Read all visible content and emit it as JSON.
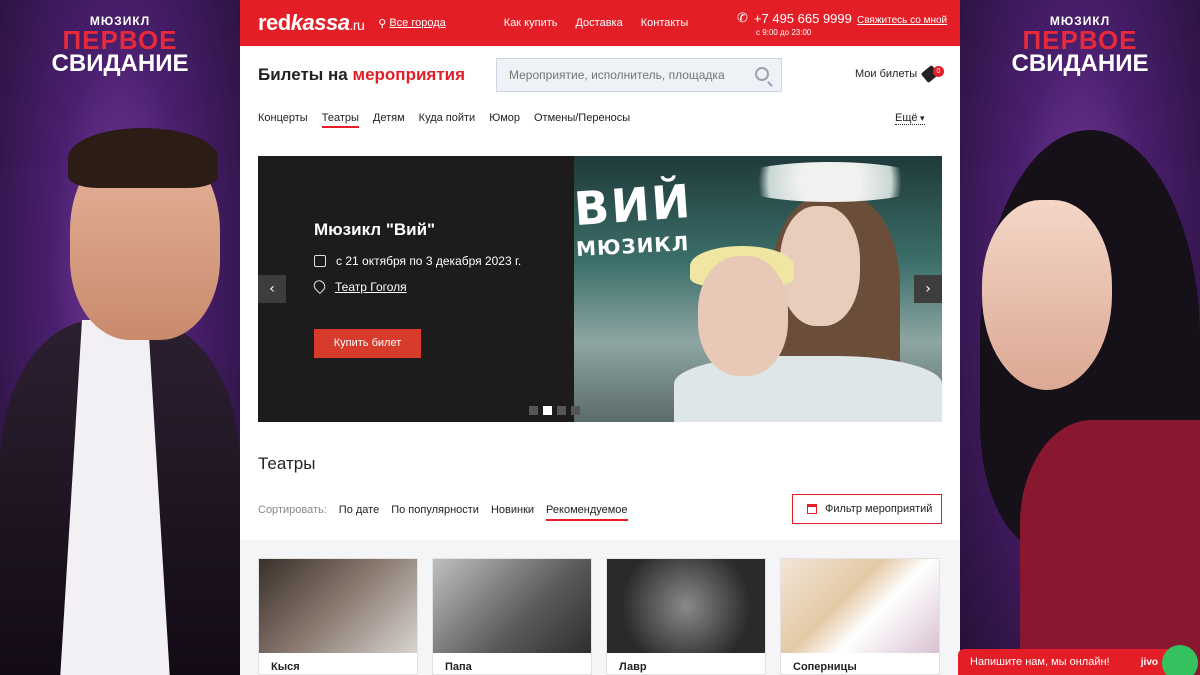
{
  "side_banner": {
    "small": "МЮЗИКЛ",
    "line1": "ПЕРВОЕ",
    "line2": "СВИДАНИЕ"
  },
  "header": {
    "logo_red": "red",
    "logo_kassa": "kassa",
    "logo_ru": ".ru",
    "city": "Все города",
    "nav": [
      "Как купить",
      "Доставка",
      "Контакты"
    ],
    "phone": "+7 495 665 9999",
    "hours": "с 9:00 до 23:00",
    "contact_link": "Свяжитесь со мной"
  },
  "title": {
    "prefix": "Билеты на",
    "accent": "мероприятия"
  },
  "search": {
    "placeholder": "Мероприятие, исполнитель, площадка"
  },
  "my_tickets": {
    "label": "Мои билеты",
    "count": "0"
  },
  "categories": [
    "Концерты",
    "Театры",
    "Детям",
    "Куда пойти",
    "Юмор",
    "Отмены/Переносы"
  ],
  "more": "Ещё",
  "slider": {
    "title": "Мюзикл \"Вий\"",
    "dates": "с 21 октября по 3 декабря 2023 г.",
    "venue": "Театр Гоголя",
    "buy": "Купить билет",
    "poster_title": "ВИЙ",
    "poster_sub": "МЮЗИКЛ",
    "prev": "‹",
    "next": "›"
  },
  "section_title": "Театры",
  "sort": {
    "label": "Сортировать:",
    "options": [
      "По дате",
      "По популярности",
      "Новинки",
      "Рекомендуемое"
    ]
  },
  "filter_button": "Фильтр мероприятий",
  "cards": [
    "Кыся",
    "Папа",
    "Лавр",
    "Соперницы"
  ],
  "chat": {
    "text": "Напишите нам, мы онлайн!",
    "brand": "jivo"
  },
  "colors": {
    "brand_red": "#e41e26",
    "button_red": "#d63b2c"
  }
}
